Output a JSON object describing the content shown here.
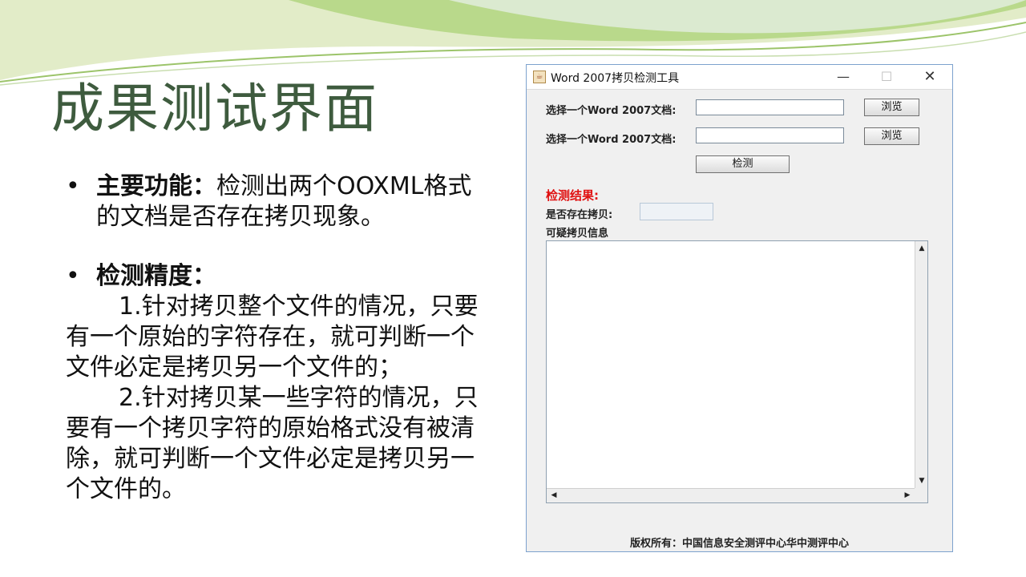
{
  "slide": {
    "title": "成果测试界面",
    "bullets": [
      {
        "label": "主要功能：",
        "text": "检测出两个OOXML格式的文档是否存在拷贝现象。"
      },
      {
        "label": "检测精度：",
        "paragraphs": [
          "1.针对拷贝整个文件的情况，只要有一个原始的字符存在，就可判断一个文件必定是拷贝另一个文件的；",
          "2.针对拷贝某一些字符的情况，只要有一个拷贝字符的原始格式没有被清除，就可判断一个文件必定是拷贝另一个文件的。"
        ]
      }
    ],
    "bullet_glyph": "•"
  },
  "window": {
    "title": "Word 2007拷贝检测工具",
    "controls": {
      "minimize": "—",
      "maximize": "☐",
      "close": "✕"
    },
    "rows": [
      {
        "label": "选择一个Word 2007文档:",
        "value": "",
        "button": "浏览"
      },
      {
        "label": "选择一个Word 2007文档:",
        "value": "",
        "button": "浏览"
      }
    ],
    "detect_button": "检测",
    "result_title": "检测结果:",
    "copy_exists_label": "是否存在拷贝:",
    "copy_exists_value": "",
    "suspicious_label": "可疑拷贝信息",
    "suspicious_text": "",
    "footer": "版权所有：中国信息安全测评中心华中测评中心"
  },
  "colors": {
    "title": "#3e5b3e",
    "accent_green": "#8cc63f",
    "result_red": "#e01010",
    "window_border": "#7da2ce"
  }
}
